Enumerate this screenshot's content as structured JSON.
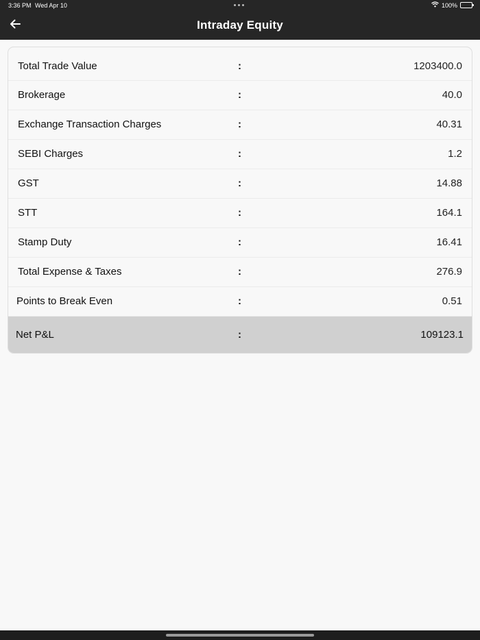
{
  "status": {
    "time": "3:36 PM",
    "date": "Wed Apr 10",
    "battery": "100%"
  },
  "nav": {
    "title": "Intraday Equity"
  },
  "separator": ":",
  "rows": [
    {
      "label": "Total Trade Value",
      "value": "1203400.0"
    },
    {
      "label": "Brokerage",
      "value": "40.0"
    },
    {
      "label": "Exchange Transaction Charges",
      "value": "40.31"
    },
    {
      "label": "SEBI Charges",
      "value": "1.2"
    },
    {
      "label": "GST",
      "value": "14.88"
    },
    {
      "label": "STT",
      "value": "164.1"
    },
    {
      "label": "Stamp Duty",
      "value": "16.41"
    },
    {
      "label": "Total Expense & Taxes",
      "value": "276.9"
    },
    {
      "label": "Points to Break Even",
      "value": "0.51"
    }
  ],
  "net": {
    "label": "Net P&L",
    "value": "109123.1"
  },
  "icons": {
    "back": "arrow-left-icon",
    "wifi": "wifi-icon",
    "battery": "battery-icon"
  }
}
